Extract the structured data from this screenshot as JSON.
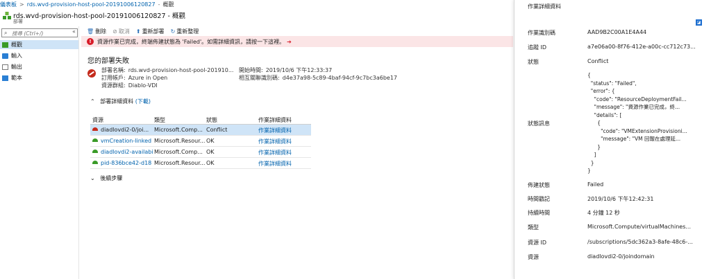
{
  "breadcrumb": {
    "home": "儀表板",
    "resource": "rds.wvd-provision-host-pool-20191006120827",
    "current": "概觀"
  },
  "header": {
    "title": "rds.wvd-provision-host-pool-20191006120827 - 概觀",
    "subtitle": "部署"
  },
  "search": {
    "placeholder": "搜尋 (Ctrl+/)"
  },
  "menu": {
    "collapse": "«",
    "items": [
      {
        "label": "概觀"
      },
      {
        "label": "輸入"
      },
      {
        "label": "輸出"
      },
      {
        "label": "範本"
      }
    ]
  },
  "toolbar": {
    "delete": "刪除",
    "cancel": "取消",
    "redeploy": "重新部署",
    "refresh": "重新整理"
  },
  "banner": {
    "text": "資源作業已完成，終端佈建狀態為 'Failed'。如需詳細資訊，請按一下這裡。"
  },
  "summary": {
    "heading": "您的部署失敗",
    "deployment_name_label": "部署名稱:",
    "deployment_name": "rds.wvd-provision-host-pool-201910...",
    "subscription_label": "訂用帳戶:",
    "subscription": "Azure in Open",
    "resource_group_label": "資源群組:",
    "resource_group": "Diablo-VDI",
    "start_time_label": "開始時間:",
    "start_time": "2019/10/6 下午12:33:37",
    "correlation_id_label": "相互關聯識別碼:",
    "correlation_id": "d4e37a98-5c89-4baf-94cf-9c7bc3a6be17"
  },
  "details": {
    "label": "部署詳細資料",
    "download": "(下載)"
  },
  "table": {
    "headers": [
      "資源",
      "類型",
      "狀態",
      "作業詳細資料"
    ],
    "rows": [
      {
        "resource": "diadlovdi2-0/joi...",
        "type": "Microsoft.Comp...",
        "status": "Conflict",
        "link": "作業詳細資料",
        "icon_color": "#c42b1c"
      },
      {
        "resource": "vmCreation-linked",
        "type": "Microsoft.Resour...",
        "status": "OK",
        "link": "作業詳細資料",
        "icon_color": "#3a9b28"
      },
      {
        "resource": "diadlovdi2-availabi",
        "type": "Microsoft.Comp...",
        "status": "OK",
        "link": "作業詳細資料",
        "icon_color": "#3a9b28"
      },
      {
        "resource": "pid-836bce42-d18",
        "type": "Microsoft.Resour...",
        "status": "OK",
        "link": "作業詳細資料",
        "icon_color": "#3a9b28"
      }
    ]
  },
  "next_steps": {
    "label": "後續步驟"
  },
  "panel": {
    "title": "作業詳細資料",
    "operation_id_label": "作業識別碼",
    "operation_id": "AAD9B2C00A1E4A44",
    "tracking_id_label": "追蹤 ID",
    "tracking_id": "a7e06a00-8f76-412e-a00c-cc712c73...",
    "status_label": "狀態",
    "status": "Conflict",
    "status_message_label": "狀態訊息",
    "status_message": "{\n  \"status\": \"Failed\",\n  \"error\": {\n    \"code\": \"ResourceDeploymentFail...\n    \"message\": \"資源作業已完成，終...\n    \"details\": [\n      {\n        \"code\": \"VMExtensionProvisioni...\n        \"message\": \"VM 回報在處理延...\n      }\n    ]\n  }\n}",
    "provisioning_state_label": "佈建狀態",
    "provisioning_state": "Failed",
    "timestamp_label": "時間戳記",
    "timestamp": "2019/10/6 下午12:42:31",
    "duration_label": "持續時間",
    "duration": "4 分鐘 12 秒",
    "type_label": "類型",
    "type": "Microsoft.Compute/virtualMachines...",
    "resource_id_label": "資源 ID",
    "resource_id": "/subscriptions/5dc362a3-8afe-48c6-...",
    "resource_label": "資源",
    "resource": "diadlovdi2-0/joindomain"
  }
}
